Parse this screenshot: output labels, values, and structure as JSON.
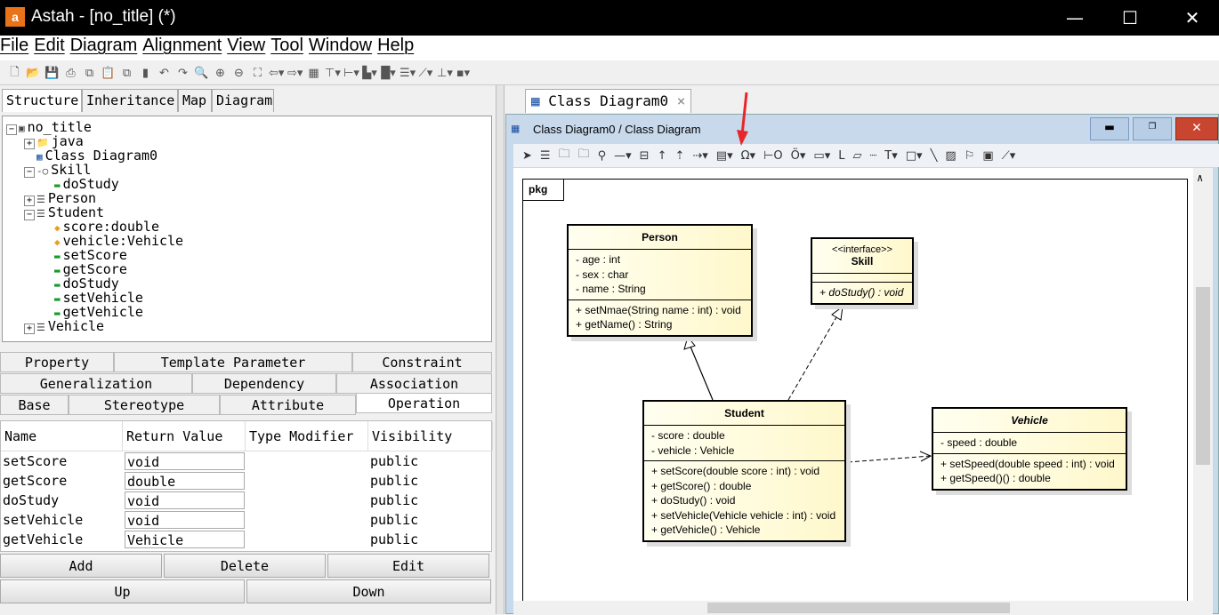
{
  "window": {
    "title": "Astah - [no_title] (*)",
    "logo": "a",
    "controls": [
      "minimize",
      "maximize",
      "close"
    ]
  },
  "menu": [
    "File",
    "Edit",
    "Diagram",
    "Alignment",
    "View",
    "Tool",
    "Window",
    "Help"
  ],
  "toolbar_icons": [
    "new-icon",
    "open-icon",
    "save-icon",
    "print-icon",
    "copy-icon",
    "paste-icon",
    "copy-diagram-icon",
    "paste-diagram-icon",
    "undo-icon",
    "redo-icon",
    "zoom-icon",
    "zoom-in-icon",
    "zoom-out-icon",
    "fit-icon",
    "back-icon",
    "forward-icon",
    "grid-icon",
    "align-top-icon",
    "align-left-icon",
    "size-icon",
    "color-icon",
    "line-icon",
    "line-style-icon",
    "layout-icon",
    "group-icon"
  ],
  "left_tabs": [
    "Structure",
    "Inheritance",
    "Map",
    "Diagram"
  ],
  "tree": [
    {
      "label": "no_title",
      "icon": "project-icon",
      "depth": 0,
      "exp": "−"
    },
    {
      "label": "java",
      "icon": "folder-icon",
      "depth": 1,
      "exp": "+"
    },
    {
      "label": "Class Diagram0",
      "icon": "diagram-icon",
      "depth": 1,
      "exp": ""
    },
    {
      "label": "Skill",
      "icon": "interface-icon",
      "depth": 1,
      "exp": "−"
    },
    {
      "label": "doStudy",
      "icon": "operation-icon",
      "depth": 2,
      "exp": ""
    },
    {
      "label": "Person",
      "icon": "class-icon",
      "depth": 1,
      "exp": "+"
    },
    {
      "label": "Student",
      "icon": "class-icon",
      "depth": 1,
      "exp": "−"
    },
    {
      "label": "score:double",
      "icon": "attribute-icon",
      "depth": 2,
      "exp": ""
    },
    {
      "label": "vehicle:Vehicle",
      "icon": "attribute-icon",
      "depth": 2,
      "exp": ""
    },
    {
      "label": "setScore",
      "icon": "operation-icon",
      "depth": 2,
      "exp": ""
    },
    {
      "label": "getScore",
      "icon": "operation-icon",
      "depth": 2,
      "exp": ""
    },
    {
      "label": "doStudy",
      "icon": "operation-icon",
      "depth": 2,
      "exp": ""
    },
    {
      "label": "setVehicle",
      "icon": "operation-icon",
      "depth": 2,
      "exp": ""
    },
    {
      "label": "getVehicle",
      "icon": "operation-icon",
      "depth": 2,
      "exp": ""
    },
    {
      "label": "Vehicle",
      "icon": "class-icon",
      "depth": 1,
      "exp": "+"
    }
  ],
  "prop_tabs": {
    "row1": [
      "Property",
      "Template Parameter",
      "Constraint"
    ],
    "row2": [
      "Generalization",
      "Dependency",
      "Association"
    ],
    "row3": [
      "Base",
      "Stereotype",
      "Attribute",
      "Operation"
    ],
    "selected": "Operation"
  },
  "op_table": {
    "headers": [
      "Name",
      "Return Value",
      "Type Modifier",
      "Visibility"
    ],
    "rows": [
      [
        "setScore",
        "void",
        "",
        "public"
      ],
      [
        "getScore",
        "double",
        "",
        "public"
      ],
      [
        "doStudy",
        "void",
        "",
        "public"
      ],
      [
        "setVehicle",
        "void",
        "",
        "public"
      ],
      [
        "getVehicle",
        "Vehicle",
        "",
        "public"
      ]
    ]
  },
  "buttons": {
    "add": "Add",
    "delete": "Delete",
    "edit": "Edit",
    "up": "Up",
    "down": "Down"
  },
  "diagram_tab": "Class Diagram0",
  "inner_title": "Class Diagram0 / Class Diagram",
  "diagram_toolbar": [
    "select-icon",
    "class-icon",
    "package-icon",
    "subsystem-icon",
    "interface-lollipop-icon",
    "association-icon",
    "association-class-icon",
    "generalization-icon",
    "realization-icon",
    "dependency-icon",
    "template-icon",
    "required-interface-icon",
    "provided-interface-icon",
    "object-icon",
    "attribute-icon",
    "line-label-icon",
    "note-icon",
    "note-anchor-icon",
    "text-icon",
    "rectangle-icon",
    "line-icon",
    "image-icon",
    "pin-icon",
    "snap-icon",
    "line-style-icon"
  ],
  "package_label": "pkg",
  "classes": [
    {
      "id": "person",
      "name": "Person",
      "stereotype": "",
      "italic": false,
      "attributes": [
        "- age : int",
        "- sex : char",
        "- name : String"
      ],
      "operations": [
        "+ setNmae(String name : int) : void",
        "+ getName() : String"
      ]
    },
    {
      "id": "skill",
      "name": "Skill",
      "stereotype": "<<interface>>",
      "italic": false,
      "attributes": [],
      "operations": [
        "+ doStudy() : void"
      ],
      "ops_italic": true
    },
    {
      "id": "student",
      "name": "Student",
      "stereotype": "",
      "italic": false,
      "attributes": [
        "- score : double",
        "- vehicle : Vehicle"
      ],
      "operations": [
        "+ setScore(double score : int) : void",
        "+ getScore() : double",
        "+ doStudy() : void",
        "+ setVehicle(Vehicle vehicle : int) : void",
        "+ getVehicle() : Vehicle"
      ]
    },
    {
      "id": "vehicle",
      "name": "Vehicle",
      "stereotype": "",
      "italic": true,
      "attributes": [
        "- speed : double"
      ],
      "operations": [
        "+ setSpeed(double speed : int) : void",
        "+ getSpeed()() : double"
      ]
    }
  ],
  "relations": [
    {
      "from": "Student",
      "to": "Person",
      "type": "generalization"
    },
    {
      "from": "Student",
      "to": "Skill",
      "type": "realization"
    },
    {
      "from": "Student",
      "to": "Vehicle",
      "type": "dependency"
    }
  ],
  "colors": {
    "class_fill": "#fff8cc",
    "annotation_arrow": "#e8252a",
    "title_bg": "#000000"
  }
}
